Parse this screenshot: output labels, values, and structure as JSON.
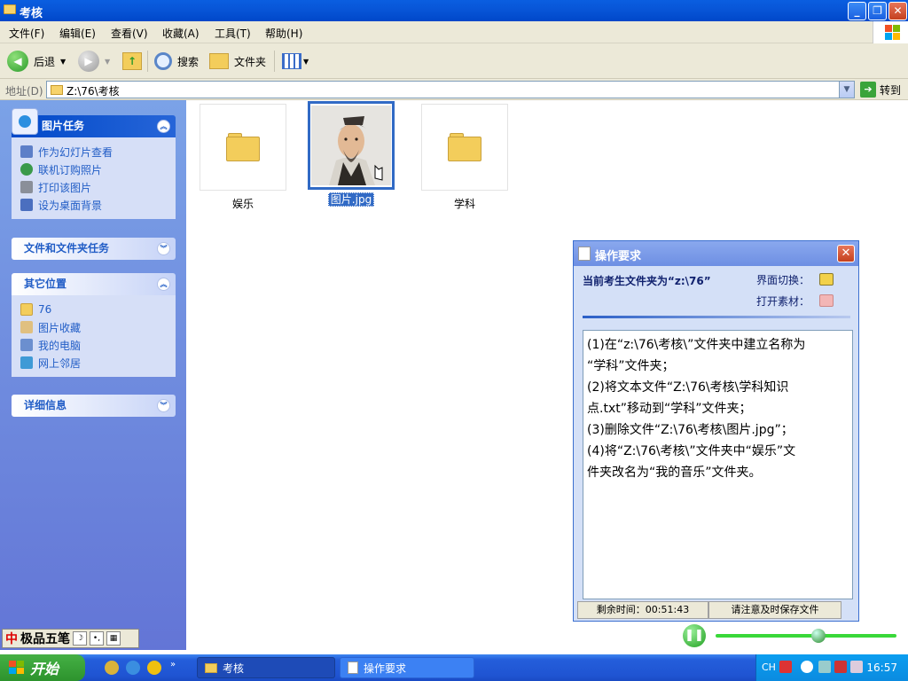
{
  "window": {
    "title": "考核"
  },
  "menu": [
    "文件(F)",
    "编辑(E)",
    "查看(V)",
    "收藏(A)",
    "工具(T)",
    "帮助(H)"
  ],
  "toolbar": {
    "back": "后退",
    "search": "搜索",
    "folders": "文件夹"
  },
  "address": {
    "label": "地址(D)",
    "value": "Z:\\76\\考核",
    "go": "转到"
  },
  "sidebar": {
    "picture_tasks": {
      "title": "图片任务",
      "items": [
        "作为幻灯片查看",
        "联机订购照片",
        "打印该图片",
        "设为桌面背景"
      ]
    },
    "file_tasks": {
      "title": "文件和文件夹任务"
    },
    "other_places": {
      "title": "其它位置",
      "items": [
        "76",
        "图片收藏",
        "我的电脑",
        "网上邻居"
      ]
    },
    "details": {
      "title": "详细信息"
    }
  },
  "files": [
    {
      "name": "娱乐",
      "type": "folder"
    },
    {
      "name": "图片.jpg",
      "type": "image"
    },
    {
      "name": "学科",
      "type": "folder"
    }
  ],
  "dialog": {
    "title": "操作要求",
    "header": "当前考生文件夹为“z:\\76”",
    "switch_label": "界面切换：",
    "open_label": "打开素材：",
    "instructions": [
      "(1)在“z:\\76\\考核\\”文件夹中建立名称为",
      "“学科”文件夹；",
      "(2)将文本文件“Z:\\76\\考核\\学科知识",
      "点.txt”移动到“学科”文件夹；",
      "(3)删除文件“Z:\\76\\考核\\图片.jpg”；",
      "(4)将“Z:\\76\\考核\\”文件夹中“娱乐”文",
      "件夹改名为“我的音乐”文件夹。"
    ],
    "remaining": "剩余时间：00:51:43",
    "save_hint": "请注意及时保存文件"
  },
  "ime": {
    "name": "极品五笔",
    "logo": "中"
  },
  "taskbar": {
    "start": "开始",
    "tasks": [
      "考核",
      "操作要求"
    ],
    "lang": "CH",
    "clock": "16:57"
  },
  "media": {
    "position": 0.57
  }
}
